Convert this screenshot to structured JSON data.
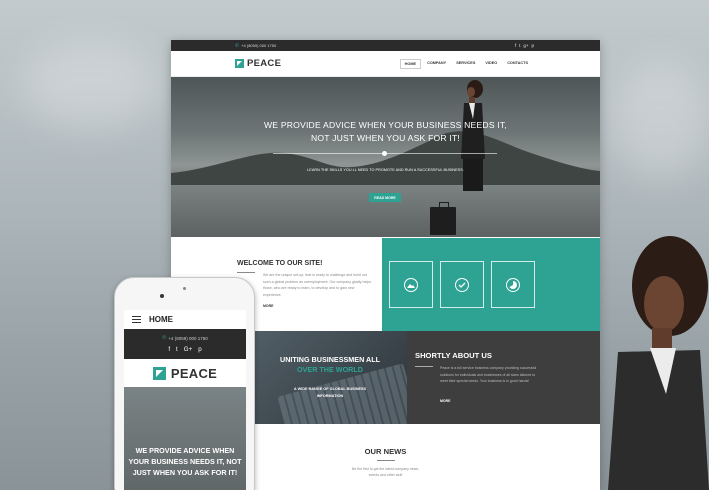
{
  "colors": {
    "accent": "#2ea394",
    "dark": "#2b2b2b",
    "about_bg": "#3e3e3e"
  },
  "desktop": {
    "topbar": {
      "phone": "+4 (8059) 000 1750",
      "phone_icon": "phone-icon",
      "socials": [
        "f",
        "t",
        "g+",
        "p"
      ]
    },
    "logo": {
      "text": "PEACE",
      "icon": "peace-logo-icon"
    },
    "nav": [
      {
        "label": "HOME",
        "active": true
      },
      {
        "label": "COMPANY",
        "active": false
      },
      {
        "label": "SERVICES",
        "active": false
      },
      {
        "label": "VIDEO",
        "active": false
      },
      {
        "label": "CONTACTS",
        "active": false
      }
    ],
    "hero": {
      "headline_1": "WE PROVIDE ADVICE WHEN YOUR BUSINESS NEEDS IT,",
      "headline_2": "NOT JUST WHEN YOU ASK FOR IT!",
      "subtext": "LEARN THE SKILLS YOU LL NEED TO PROMOTE AND RUN A SUCCESSFUL BUSINESS.",
      "button": "READ MORE"
    },
    "welcome": {
      "title": "WELCOME TO OUR SITE!",
      "text": "We are the unique set-up, that is ready to challenge and build our such a global problem as unemployment. Our company gladly helps those, who are ready to learn, to develop and to gain new experience.",
      "more": "MORE"
    },
    "features": [
      {
        "icon": "landscape-icon"
      },
      {
        "icon": "checkmark-icon"
      },
      {
        "icon": "pie-chart-icon"
      }
    ],
    "uniting": {
      "title_1": "UNITING BUSINESSMEN ALL",
      "title_2": "OVER THE WORLD",
      "caption": "A WIDE RANGE OF GLOBAL BUSINESS INFORMATION"
    },
    "about": {
      "title": "SHORTLY ABOUT US",
      "text": "Peace is a full service business company providing successful solutions for individuals and businesses of all sizes tailored to meet their special needs. Your business is in good hands!",
      "more": "MORE"
    },
    "news": {
      "title": "OUR NEWS",
      "text": "Be the first to get the latest company news, events and other stuff"
    }
  },
  "mobile": {
    "menu_label": "HOME",
    "menu_icon": "hamburger-menu-icon",
    "phone": "+4 (8059) 000 1750",
    "socials": [
      "f",
      "t",
      "G+",
      "p"
    ],
    "logo_text": "PEACE",
    "hero_headline": "WE PROVIDE ADVICE WHEN YOUR BUSINESS NEEDS IT, NOT JUST WHEN YOU ASK FOR IT!"
  }
}
